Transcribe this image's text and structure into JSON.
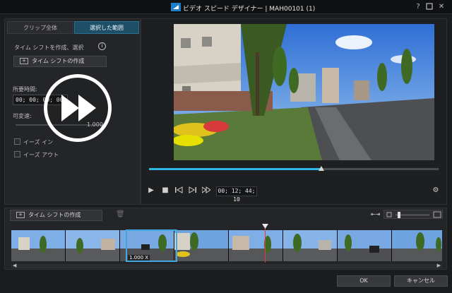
{
  "window": {
    "title": "ビデオ スピード デザイナー  |  MAH00101 (1)"
  },
  "left_panel": {
    "tabs": [
      {
        "label": "クリップ全体",
        "active": false
      },
      {
        "label": "選択した範囲",
        "active": true
      }
    ],
    "section_label": "タイム シフトを作成、選択",
    "create_button": "タイム シフトの作成",
    "duration_label": "所要時間:",
    "duration_value": "00; 00; 00; 00",
    "speed_label": "可変速:",
    "speed_value": "1.000",
    "ease_in_label": "イーズ イン",
    "ease_out_label": "イーズ アウト"
  },
  "preview": {
    "timecode": "00; 12; 44; 10",
    "seek_progress": 0.6
  },
  "timeline": {
    "create_button": "タイム シフトの作成",
    "selected_frame_label": "1.000 X"
  },
  "footer": {
    "ok_label": "OK",
    "cancel_label": "キャンセル"
  },
  "colors": {
    "accent": "#2fb7e6",
    "selected_tab": "#1f4f66",
    "playhead": "#e23b3b"
  }
}
